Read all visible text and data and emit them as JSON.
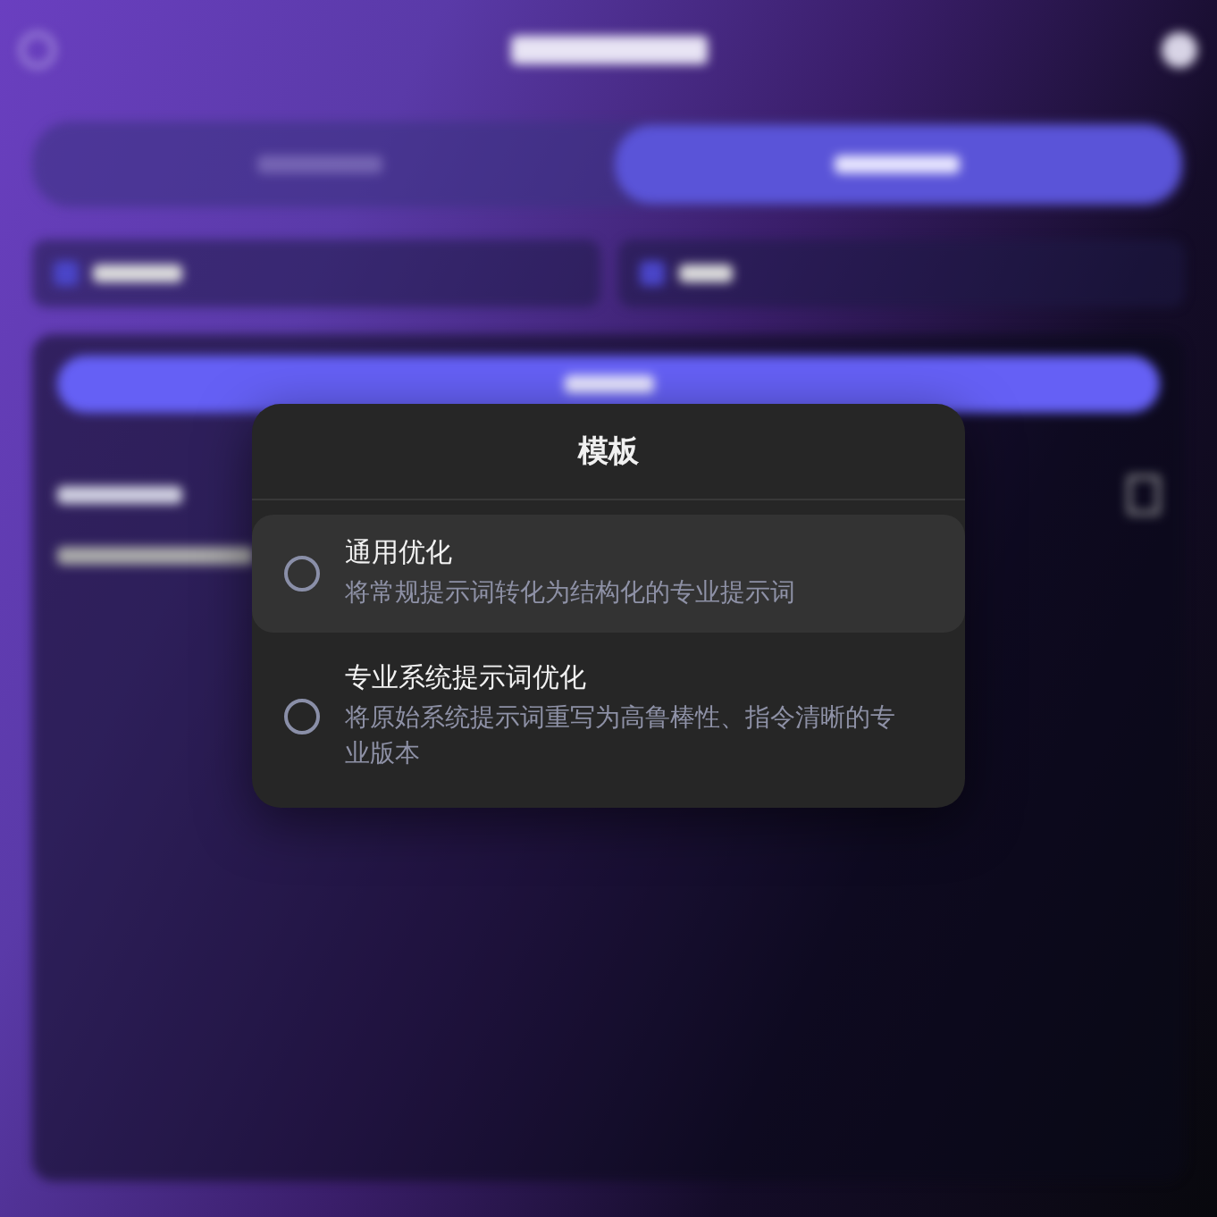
{
  "backdrop": {
    "tabs": [
      {
        "selected": false
      },
      {
        "selected": true
      }
    ]
  },
  "dialog": {
    "title": "模板",
    "options": [
      {
        "title": "通用优化",
        "description": "将常规提示词转化为结构化的专业提示词",
        "selected": false,
        "highlighted": true
      },
      {
        "title": "专业系统提示词优化",
        "description": "将原始系统提示词重写为高鲁棒性、指令清晰的专业版本",
        "selected": false,
        "highlighted": false
      }
    ]
  }
}
